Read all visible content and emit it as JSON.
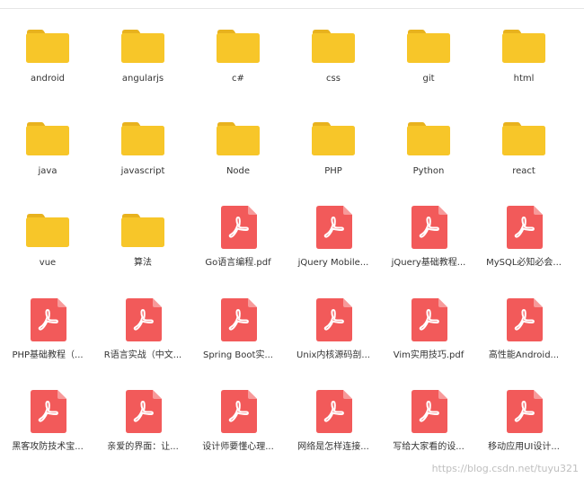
{
  "colors": {
    "folder": "#F7C629",
    "folder_tab": "#E8B21E",
    "pdf": "#F25A5A",
    "pdf_fold": "#F79A9A",
    "label": "#333333"
  },
  "items": [
    {
      "type": "folder",
      "icon": "folder-icon",
      "label": "android"
    },
    {
      "type": "folder",
      "icon": "folder-icon",
      "label": "angularjs"
    },
    {
      "type": "folder",
      "icon": "folder-icon",
      "label": "c#"
    },
    {
      "type": "folder",
      "icon": "folder-icon",
      "label": "css"
    },
    {
      "type": "folder",
      "icon": "folder-icon",
      "label": "git"
    },
    {
      "type": "folder",
      "icon": "folder-icon",
      "label": "html"
    },
    {
      "type": "folder",
      "icon": "folder-icon",
      "label": "java"
    },
    {
      "type": "folder",
      "icon": "folder-icon",
      "label": "javascript"
    },
    {
      "type": "folder",
      "icon": "folder-icon",
      "label": "Node"
    },
    {
      "type": "folder",
      "icon": "folder-icon",
      "label": "PHP"
    },
    {
      "type": "folder",
      "icon": "folder-icon",
      "label": "Python"
    },
    {
      "type": "folder",
      "icon": "folder-icon",
      "label": "react"
    },
    {
      "type": "folder",
      "icon": "folder-icon",
      "label": "vue"
    },
    {
      "type": "folder",
      "icon": "folder-icon",
      "label": "算法"
    },
    {
      "type": "pdf",
      "icon": "pdf-file-icon",
      "label": "Go语言编程.pdf"
    },
    {
      "type": "pdf",
      "icon": "pdf-file-icon",
      "label": "jQuery Mobile..."
    },
    {
      "type": "pdf",
      "icon": "pdf-file-icon",
      "label": "jQuery基础教程..."
    },
    {
      "type": "pdf",
      "icon": "pdf-file-icon",
      "label": "MySQL必知必会..."
    },
    {
      "type": "pdf",
      "icon": "pdf-file-icon",
      "label": "PHP基础教程（..."
    },
    {
      "type": "pdf",
      "icon": "pdf-file-icon",
      "label": "R语言实战（中文..."
    },
    {
      "type": "pdf",
      "icon": "pdf-file-icon",
      "label": "Spring Boot实..."
    },
    {
      "type": "pdf",
      "icon": "pdf-file-icon",
      "label": "Unix内核源码剖..."
    },
    {
      "type": "pdf",
      "icon": "pdf-file-icon",
      "label": "Vim实用技巧.pdf"
    },
    {
      "type": "pdf",
      "icon": "pdf-file-icon",
      "label": "高性能Android..."
    },
    {
      "type": "pdf",
      "icon": "pdf-file-icon",
      "label": "黑客攻防技术宝..."
    },
    {
      "type": "pdf",
      "icon": "pdf-file-icon",
      "label": "亲爱的界面：让..."
    },
    {
      "type": "pdf",
      "icon": "pdf-file-icon",
      "label": "设计师要懂心理..."
    },
    {
      "type": "pdf",
      "icon": "pdf-file-icon",
      "label": "网络是怎样连接..."
    },
    {
      "type": "pdf",
      "icon": "pdf-file-icon",
      "label": "写给大家看的设..."
    },
    {
      "type": "pdf",
      "icon": "pdf-file-icon",
      "label": "移动应用UI设计..."
    }
  ],
  "watermark": "https://blog.csdn.net/tuyu321"
}
